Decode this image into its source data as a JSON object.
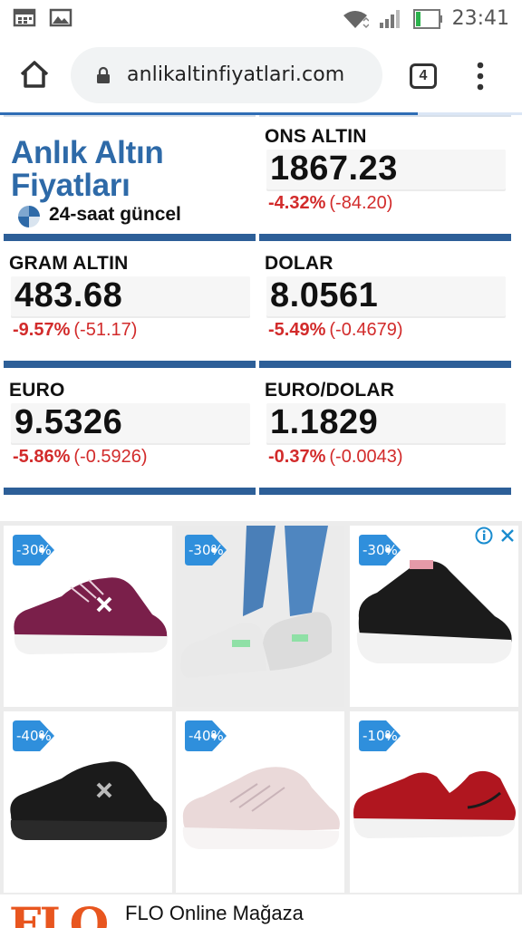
{
  "status_bar": {
    "time": "23:41",
    "left_icons": [
      "calendar-icon",
      "image-icon"
    ],
    "right_icons": [
      "wifi-icon",
      "signal-icon",
      "battery-icon"
    ],
    "battery_color": "#2bb24c"
  },
  "browser": {
    "url": "anlikaltinfiyatlari.com",
    "tab_count": "4",
    "page_load_progress": 0.8
  },
  "site": {
    "logo_line1": "Anlık Altın",
    "logo_line2": "Fiyatları",
    "logo_subtitle": "24-saat güncel",
    "accent_color": "#2d5f98",
    "negative_color": "#d22b2b"
  },
  "prices": [
    {
      "title": "ONS ALTIN",
      "value": "1867.23",
      "change_pct": "-4.32%",
      "change_abs": "(-84.20)"
    },
    {
      "title": "GRAM ALTIN",
      "value": "483.68",
      "change_pct": "-9.57%",
      "change_abs": "(-51.17)"
    },
    {
      "title": "DOLAR",
      "value": "8.0561",
      "change_pct": "-5.49%",
      "change_abs": "(-0.4679)"
    },
    {
      "title": "EURO",
      "value": "9.5326",
      "change_pct": "-5.86%",
      "change_abs": "(-0.5926)"
    },
    {
      "title": "EURO/DOLAR",
      "value": "1.1829",
      "change_pct": "-0.37%",
      "change_abs": "(-0.0043)"
    }
  ],
  "ad": {
    "products": [
      {
        "discount": "-30%",
        "color": "#7a1f4a"
      },
      {
        "discount": "-30%",
        "color": "#e8e8e8"
      },
      {
        "discount": "-30%",
        "color": "#1b1b1b"
      },
      {
        "discount": "-40%",
        "color": "#1b1b1b"
      },
      {
        "discount": "-40%",
        "color": "#ead9d9"
      },
      {
        "discount": "-10%",
        "color": "#b0161f"
      }
    ],
    "badge_color": "#2f8fdc",
    "brand": "FLO",
    "title": "FLO Online Mağaza"
  }
}
